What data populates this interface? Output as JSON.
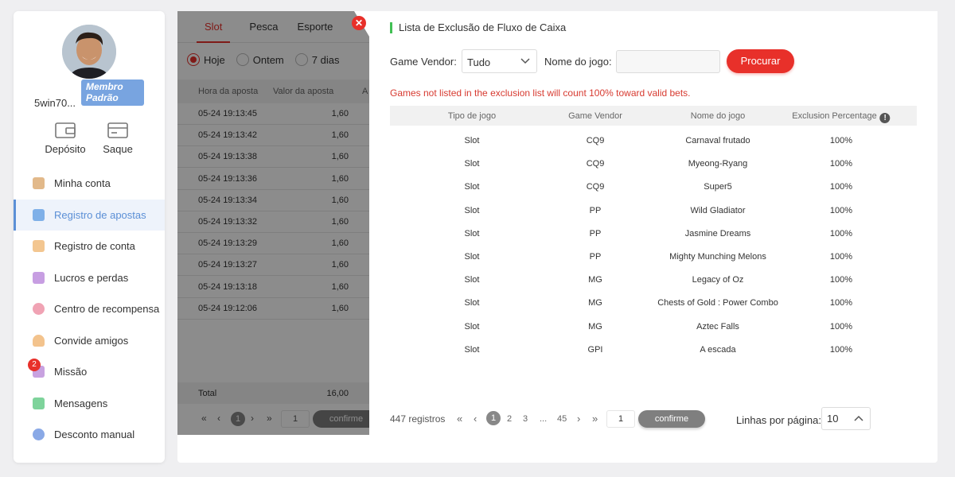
{
  "sidebar": {
    "username": "5win70...",
    "member_level": "Membro Padrão",
    "deposit_label": "Depósito",
    "withdraw_label": "Saque",
    "items": [
      {
        "label": "Minha conta",
        "icon": "wallet-stack-icon",
        "color": "#e2b98a"
      },
      {
        "label": "Registro de apostas",
        "icon": "bet-record-icon",
        "color": "#7fb0e8",
        "active": true
      },
      {
        "label": "Registro de conta",
        "icon": "account-record-icon",
        "color": "#f3c690"
      },
      {
        "label": "Lucros e perdas",
        "icon": "profit-loss-icon",
        "color": "#c79ee2"
      },
      {
        "label": "Centro de recompensa",
        "icon": "reward-icon",
        "color": "#f0a3b4"
      },
      {
        "label": "Convide amigos",
        "icon": "invite-friends-icon",
        "color": "#f3c38d"
      },
      {
        "label": "Missão",
        "icon": "mission-icon",
        "color": "#c8a2e0",
        "badge": "2"
      },
      {
        "label": "Mensagens",
        "icon": "messages-icon",
        "color": "#7ed39b"
      },
      {
        "label": "Desconto manual",
        "icon": "discount-icon",
        "color": "#8aa9e6"
      }
    ]
  },
  "bet_panel": {
    "tabs": [
      "Slot",
      "Pesca",
      "Esporte"
    ],
    "date_options": [
      "Hoje",
      "Ontem",
      "7 dias"
    ],
    "columns": [
      "Hora da aposta",
      "Valor da aposta",
      "A"
    ],
    "rows": [
      {
        "time": "05-24 19:13:45",
        "value": "1,60"
      },
      {
        "time": "05-24 19:13:42",
        "value": "1,60"
      },
      {
        "time": "05-24 19:13:38",
        "value": "1,60"
      },
      {
        "time": "05-24 19:13:36",
        "value": "1,60"
      },
      {
        "time": "05-24 19:13:34",
        "value": "1,60"
      },
      {
        "time": "05-24 19:13:32",
        "value": "1,60"
      },
      {
        "time": "05-24 19:13:29",
        "value": "1,60"
      },
      {
        "time": "05-24 19:13:27",
        "value": "1,60"
      },
      {
        "time": "05-24 19:13:18",
        "value": "1,60"
      },
      {
        "time": "05-24 19:12:06",
        "value": "1,60"
      }
    ],
    "total_label": "Total",
    "total_value": "16,00",
    "pager": {
      "current": "1",
      "input": "1",
      "confirm": "confirme"
    }
  },
  "modal": {
    "title": "Lista de Exclusão de Fluxo de Caixa",
    "vendor_label": "Game Vendor",
    "vendor_value": "Tudo",
    "game_name_label": "Nome do jogo",
    "game_name_value": "",
    "search_label": "Procurar",
    "warning": "Games not listed in the exclusion list will count 100% toward valid bets.",
    "columns": [
      "Tipo de jogo",
      "Game Vendor",
      "Nome do jogo",
      "Exclusion Percentage"
    ],
    "rows": [
      {
        "type": "Slot",
        "vendor": "CQ9",
        "game": "Carnaval frutado",
        "pct": "100%"
      },
      {
        "type": "Slot",
        "vendor": "CQ9",
        "game": "Myeong-Ryang",
        "pct": "100%"
      },
      {
        "type": "Slot",
        "vendor": "CQ9",
        "game": "Super5",
        "pct": "100%"
      },
      {
        "type": "Slot",
        "vendor": "PP",
        "game": "Wild Gladiator",
        "pct": "100%"
      },
      {
        "type": "Slot",
        "vendor": "PP",
        "game": "Jasmine Dreams",
        "pct": "100%"
      },
      {
        "type": "Slot",
        "vendor": "PP",
        "game": "Mighty Munching Melons",
        "pct": "100%"
      },
      {
        "type": "Slot",
        "vendor": "MG",
        "game": "Legacy of Oz",
        "pct": "100%"
      },
      {
        "type": "Slot",
        "vendor": "MG",
        "game": "Chests of Gold : Power Combo",
        "pct": "100%"
      },
      {
        "type": "Slot",
        "vendor": "MG",
        "game": "Aztec Falls",
        "pct": "100%"
      },
      {
        "type": "Slot",
        "vendor": "GPI",
        "game": "A escada",
        "pct": "100%"
      }
    ],
    "pager": {
      "records": "447 registros",
      "pages": [
        "1",
        "2",
        "3",
        "...",
        "45"
      ],
      "input": "1",
      "confirm": "confirme",
      "rows_per_page_label": "Linhas por página",
      "rows_per_page": "10"
    }
  },
  "colors": {
    "accent": "#e8302a",
    "active_blue": "#5b8fd6",
    "title_bar": "#41c054"
  }
}
